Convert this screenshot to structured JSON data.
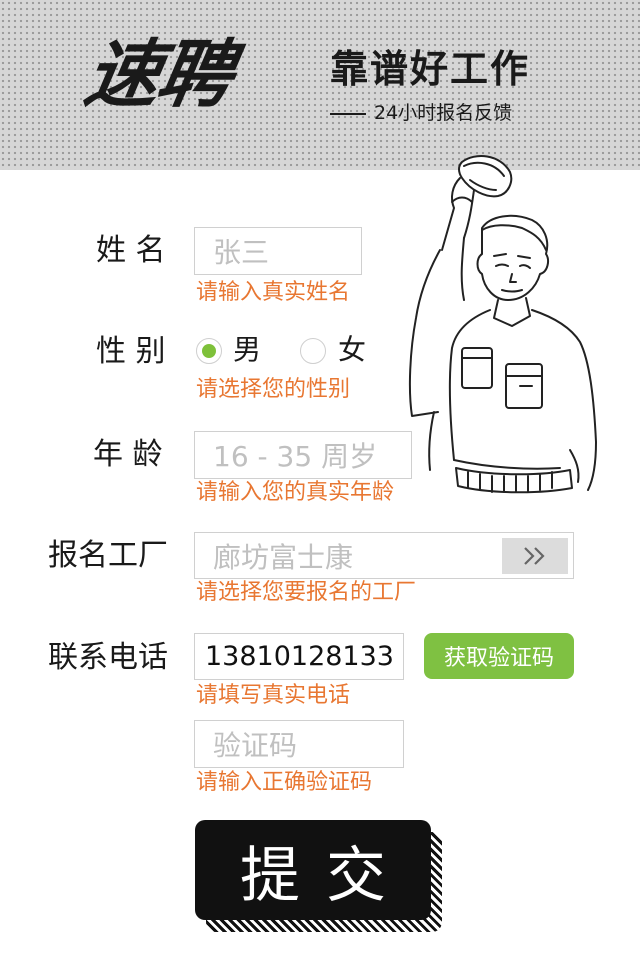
{
  "header": {
    "logo_text": "速聘",
    "slogan": "靠谱好工作",
    "subline": "24小时报名反馈"
  },
  "form": {
    "name": {
      "label": "姓 名",
      "placeholder": "张三",
      "hint": "请输入真实姓名"
    },
    "gender": {
      "label": "性 别",
      "options": [
        "男",
        "女"
      ],
      "selected": "男",
      "hint": "请选择您的性别"
    },
    "age": {
      "label": "年 龄",
      "placeholder": "16 - 35 周岁",
      "hint": "请输入您的真实年龄"
    },
    "factory": {
      "label": "报名工厂",
      "placeholder": "廊坊富士康",
      "hint": "请选择您要报名的工厂"
    },
    "phone": {
      "label": "联系电话",
      "value": "13810128133",
      "hint": "请填写真实电话",
      "verify_button": "获取验证码"
    },
    "code": {
      "placeholder": "验证码",
      "hint": "请输入正确验证码"
    },
    "submit_label": "提交"
  },
  "colors": {
    "accent_green": "#7fc142",
    "hint_orange": "#e87732",
    "header_bg": "#d6d6d6"
  },
  "icons": {
    "factory_select": "double-chevron-right-icon",
    "illustration": "worker-tipping-cap"
  }
}
